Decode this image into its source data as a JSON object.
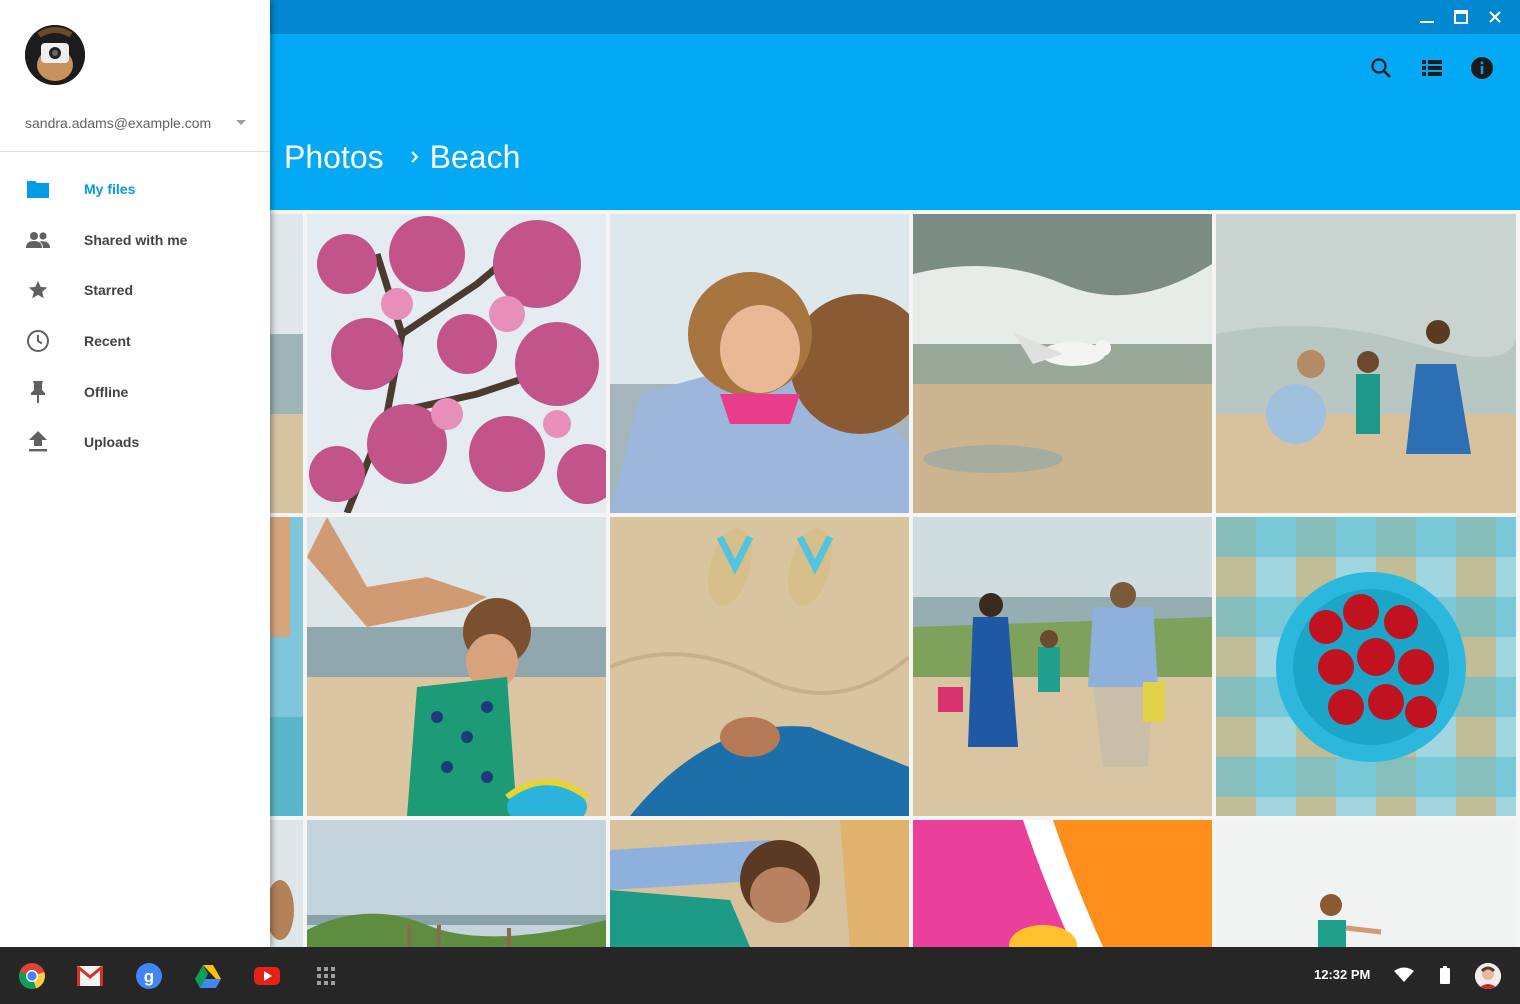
{
  "window": {
    "controls": [
      "minimize-icon",
      "maximize-icon",
      "close-icon"
    ]
  },
  "appbar": {
    "actions": [
      "search-icon",
      "list-view-icon",
      "info-icon"
    ],
    "breadcrumb": [
      "Photos",
      "Beach"
    ],
    "colors": {
      "titlebar": "#0288d1",
      "appbar": "#03a9f4"
    }
  },
  "drawer": {
    "account_email": "sandra.adams@example.com",
    "nav": [
      {
        "label": "My files",
        "icon": "folder-icon",
        "active": true
      },
      {
        "label": "Shared with me",
        "icon": "people-icon",
        "active": false
      },
      {
        "label": "Starred",
        "icon": "star-icon",
        "active": false
      },
      {
        "label": "Recent",
        "icon": "clock-icon",
        "active": false
      },
      {
        "label": "Offline",
        "icon": "pin-icon",
        "active": false
      },
      {
        "label": "Uploads",
        "icon": "upload-icon",
        "active": false
      }
    ],
    "accent_color": "#039be5"
  },
  "photos": [
    "beach-shore",
    "pink-blossom-branch",
    "smiling-girl-hug",
    "seagull-on-shore",
    "family-on-beach",
    "girl-arm-partial",
    "girl-hair-touch",
    "flip-flops-in-sand",
    "family-walking-dunes",
    "cherries-in-bowl",
    "beach-partial",
    "dunes-fence",
    "woman-laughing",
    "orange-pink-towel",
    "child-jumping"
  ],
  "shelf": {
    "apps": [
      "chrome-icon",
      "gmail-icon",
      "google-search-icon",
      "drive-icon",
      "youtube-icon",
      "app-launcher-icon"
    ],
    "time": "12:32 PM",
    "tray": [
      "wifi-icon",
      "battery-icon",
      "user-avatar"
    ]
  }
}
